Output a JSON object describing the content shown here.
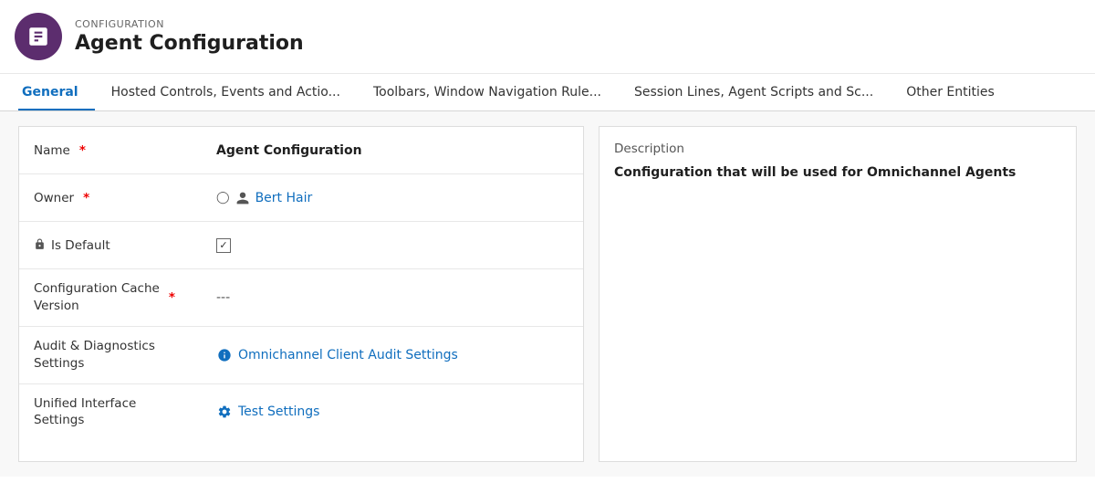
{
  "header": {
    "subtitle": "CONFIGURATION",
    "title": "Agent Configuration",
    "icon_label": "agent-config-icon"
  },
  "tabs": [
    {
      "id": "general",
      "label": "General",
      "active": true
    },
    {
      "id": "hosted-controls",
      "label": "Hosted Controls, Events and Actio...",
      "active": false
    },
    {
      "id": "toolbars",
      "label": "Toolbars, Window Navigation Rule...",
      "active": false
    },
    {
      "id": "session-lines",
      "label": "Session Lines, Agent Scripts and Sc...",
      "active": false
    },
    {
      "id": "other-entities",
      "label": "Other Entities",
      "active": false
    }
  ],
  "form": {
    "fields": [
      {
        "id": "name",
        "label": "Name",
        "required": true,
        "has_lock": false,
        "value": "Agent Configuration",
        "value_bold": true,
        "type": "text"
      },
      {
        "id": "owner",
        "label": "Owner",
        "required": true,
        "has_lock": false,
        "value": "Bert Hair",
        "type": "owner"
      },
      {
        "id": "is-default",
        "label": "Is Default",
        "required": false,
        "has_lock": true,
        "value": "",
        "type": "checkbox"
      },
      {
        "id": "config-cache-version",
        "label": "Configuration Cache\nVersion",
        "required": true,
        "has_lock": false,
        "value": "---",
        "type": "muted"
      },
      {
        "id": "audit-diagnostics",
        "label": "Audit & Diagnostics\nSettings",
        "required": false,
        "has_lock": false,
        "value": "Omnichannel Client Audit Settings",
        "type": "link"
      },
      {
        "id": "unified-interface",
        "label": "Unified Interface\nSettings",
        "required": false,
        "has_lock": false,
        "value": "Test Settings",
        "type": "link"
      }
    ]
  },
  "description": {
    "label": "Description",
    "value": "Configuration that will be used for Omnichannel Agents"
  }
}
